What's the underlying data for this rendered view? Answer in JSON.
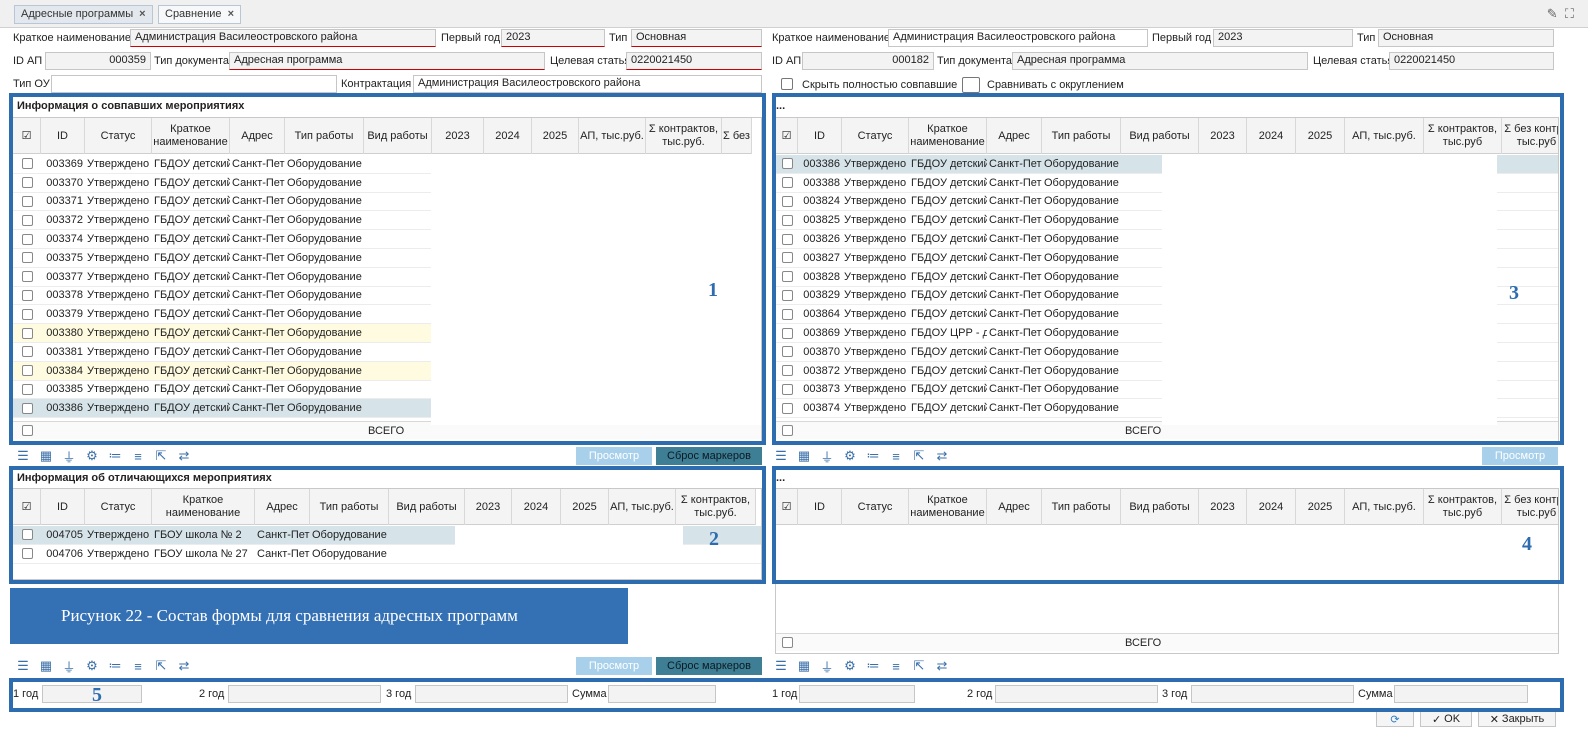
{
  "tabs": [
    {
      "label": "Адресные программы"
    },
    {
      "label": "Сравнение"
    }
  ],
  "icons": {
    "edit": "pencil-icon",
    "fullscreen": "expand-icon"
  },
  "left_header": {
    "short_name_label": "Краткое наименование",
    "short_name": "Администрация Василеостровского района",
    "first_year_label": "Первый год",
    "first_year": "2023",
    "type_label": "Тип",
    "type": "Основная",
    "id_label": "ID АП",
    "id": "000359",
    "doc_type_label": "Тип документа",
    "doc_type": "Адресная программа",
    "target_label": "Целевая статья",
    "target": "0220021450",
    "ou_label": "Тип ОУ",
    "ou": "",
    "contract_label": "Контрактация",
    "contract": "Администрация Василеостровского района"
  },
  "right_header": {
    "short_name_label": "Краткое наименование",
    "short_name": "Администрация Василеостровского района",
    "first_year_label": "Первый год",
    "first_year": "2023",
    "type_label": "Тип",
    "type": "Основная",
    "id_label": "ID АП",
    "id": "000182",
    "doc_type_label": "Тип документа",
    "doc_type": "Адресная программа",
    "target_label": "Целевая статья",
    "target": "0220021450",
    "hide_label": "Скрыть полностью совпавшие",
    "round_label": "Сравнивать с округлением"
  },
  "left_top": {
    "title": "Информация о совпавших мероприятиях",
    "columns": [
      "ID",
      "Статус",
      "Краткое\nнаименование",
      "Адрес",
      "Тип работы",
      "Вид работы",
      "2023",
      "2024",
      "2025",
      "АП, тыс.руб.",
      "Σ контрактов,\nтыс.руб.",
      "Σ без"
    ],
    "rows": [
      {
        "id": "003369",
        "status": "Утверждено",
        "name": "ГБДОУ детский",
        "addr": "Санкт-Петер",
        "work": "Оборудование"
      },
      {
        "id": "003370",
        "status": "Утверждено",
        "name": "ГБДОУ детский",
        "addr": "Санкт-Петер",
        "work": "Оборудование"
      },
      {
        "id": "003371",
        "status": "Утверждено",
        "name": "ГБДОУ детский",
        "addr": "Санкт-Петер",
        "work": "Оборудование"
      },
      {
        "id": "003372",
        "status": "Утверждено",
        "name": "ГБДОУ детский",
        "addr": "Санкт-Петер",
        "work": "Оборудование"
      },
      {
        "id": "003374",
        "status": "Утверждено",
        "name": "ГБДОУ детский",
        "addr": "Санкт-Петер",
        "work": "Оборудование"
      },
      {
        "id": "003375",
        "status": "Утверждено",
        "name": "ГБДОУ детский",
        "addr": "Санкт-Петер",
        "work": "Оборудование"
      },
      {
        "id": "003377",
        "status": "Утверждено",
        "name": "ГБДОУ детский",
        "addr": "Санкт-Петер",
        "work": "Оборудование"
      },
      {
        "id": "003378",
        "status": "Утверждено",
        "name": "ГБДОУ детский",
        "addr": "Санкт-Петер",
        "work": "Оборудование"
      },
      {
        "id": "003379",
        "status": "Утверждено",
        "name": "ГБДОУ детский",
        "addr": "Санкт-Петер",
        "work": "Оборудование"
      },
      {
        "id": "003380",
        "status": "Утверждено",
        "name": "ГБДОУ детский",
        "addr": "Санкт-Петер",
        "work": "Оборудование",
        "hl": "yel"
      },
      {
        "id": "003381",
        "status": "Утверждено",
        "name": "ГБДОУ детский",
        "addr": "Санкт-Петер",
        "work": "Оборудование"
      },
      {
        "id": "003384",
        "status": "Утверждено",
        "name": "ГБДОУ детский",
        "addr": "Санкт-Петер",
        "work": "Оборудование",
        "hl": "yel"
      },
      {
        "id": "003385",
        "status": "Утверждено",
        "name": "ГБДОУ детский",
        "addr": "Санкт-Петер",
        "work": "Оборудование"
      },
      {
        "id": "003386",
        "status": "Утверждено",
        "name": "ГБДОУ детский",
        "addr": "Санкт-Петер",
        "work": "Оборудование",
        "hl": "sel"
      }
    ],
    "total": "ВСЕГО",
    "btn_view": "Просмотр",
    "btn_reset": "Сброс маркеров",
    "marker": "1"
  },
  "right_top": {
    "title": "...",
    "columns": [
      "ID",
      "Статус",
      "Краткое\nнаименование",
      "Адрес",
      "Тип работы",
      "Вид работы",
      "2023",
      "2024",
      "2025",
      "АП, тыс.руб.",
      "Σ контрактов,\nтыс.руб",
      "Σ без контра\nтыс.руб"
    ],
    "rows": [
      {
        "id": "003386",
        "status": "Утверждено",
        "name": "ГБДОУ детский",
        "addr": "Санкт-Петер",
        "work": "Оборудование",
        "hl": "sel"
      },
      {
        "id": "003388",
        "status": "Утверждено",
        "name": "ГБДОУ детский",
        "addr": "Санкт-Петер",
        "work": "Оборудование"
      },
      {
        "id": "003824",
        "status": "Утверждено",
        "name": "ГБДОУ детский",
        "addr": "Санкт-Петер",
        "work": "Оборудование"
      },
      {
        "id": "003825",
        "status": "Утверждено",
        "name": "ГБДОУ детский",
        "addr": "Санкт-Петер",
        "work": "Оборудование"
      },
      {
        "id": "003826",
        "status": "Утверждено",
        "name": "ГБДОУ детский",
        "addr": "Санкт-Петер",
        "work": "Оборудование"
      },
      {
        "id": "003827",
        "status": "Утверждено",
        "name": "ГБДОУ детский",
        "addr": "Санкт-Петер",
        "work": "Оборудование"
      },
      {
        "id": "003828",
        "status": "Утверждено",
        "name": "ГБДОУ детский",
        "addr": "Санкт-Петер",
        "work": "Оборудование"
      },
      {
        "id": "003829",
        "status": "Утверждено",
        "name": "ГБДОУ детский",
        "addr": "Санкт-Петер",
        "work": "Оборудование"
      },
      {
        "id": "003864",
        "status": "Утверждено",
        "name": "ГБДОУ детский",
        "addr": "Санкт-Петер",
        "work": "Оборудование"
      },
      {
        "id": "003869",
        "status": "Утверждено",
        "name": "ГБДОУ ЦРР - де",
        "addr": "Санкт-Петер",
        "work": "Оборудование"
      },
      {
        "id": "003870",
        "status": "Утверждено",
        "name": "ГБДОУ детский",
        "addr": "Санкт-Петер",
        "work": "Оборудование"
      },
      {
        "id": "003872",
        "status": "Утверждено",
        "name": "ГБДОУ детский",
        "addr": "Санкт-Петер",
        "work": "Оборудование"
      },
      {
        "id": "003873",
        "status": "Утверждено",
        "name": "ГБДОУ детский",
        "addr": "Санкт-Петер",
        "work": "Оборудование"
      },
      {
        "id": "003874",
        "status": "Утверждено",
        "name": "ГБДОУ детский",
        "addr": "Санкт-Петер",
        "work": "Оборудование"
      }
    ],
    "total": "ВСЕГО",
    "btn_view": "Просмотр",
    "marker": "3"
  },
  "left_bottom": {
    "title": "Информация об отличающихся мероприятиях",
    "columns": [
      "ID",
      "Статус",
      "Краткое\nнаименование",
      "Адрес",
      "Тип работы",
      "Вид работы",
      "2023",
      "2024",
      "2025",
      "АП, тыс.руб.",
      "Σ контрактов,\nтыс.руб."
    ],
    "rows": [
      {
        "id": "004705",
        "status": "Утверждено",
        "name": "ГБОУ школа № 2",
        "addr": "Санкт-Петер",
        "work": "Оборудование",
        "hl": "sel"
      },
      {
        "id": "004706",
        "status": "Утверждено",
        "name": "ГБОУ школа № 27",
        "addr": "Санкт-Петер",
        "work": "Оборудование"
      }
    ],
    "btn_view": "Просмотр",
    "btn_reset": "Сброс маркеров",
    "marker": "2"
  },
  "right_bottom": {
    "title": "...",
    "columns": [
      "ID",
      "Статус",
      "Краткое\nнаименование",
      "Адрес",
      "Тип работы",
      "Вид работы",
      "2023",
      "2024",
      "2025",
      "АП, тыс.руб.",
      "Σ контрактов,\nтыс.руб",
      "Σ без контра\nтыс.руб"
    ],
    "total": "ВСЕГО",
    "marker": "4"
  },
  "caption": "Рисунок 22 - Состав формы для сравнения адресных программ",
  "sums": {
    "y1": "1 год",
    "y2": "2 год",
    "y3": "3 год",
    "sum": "Сумма",
    "marker": "5"
  },
  "actions": {
    "ok": "OK",
    "close": "Закрыть",
    "refresh": "refresh-icon"
  },
  "colors": {
    "accent": "#2e6cb0",
    "selected_row": "#d6e4ea",
    "highlight_row": "#fffbe0"
  }
}
